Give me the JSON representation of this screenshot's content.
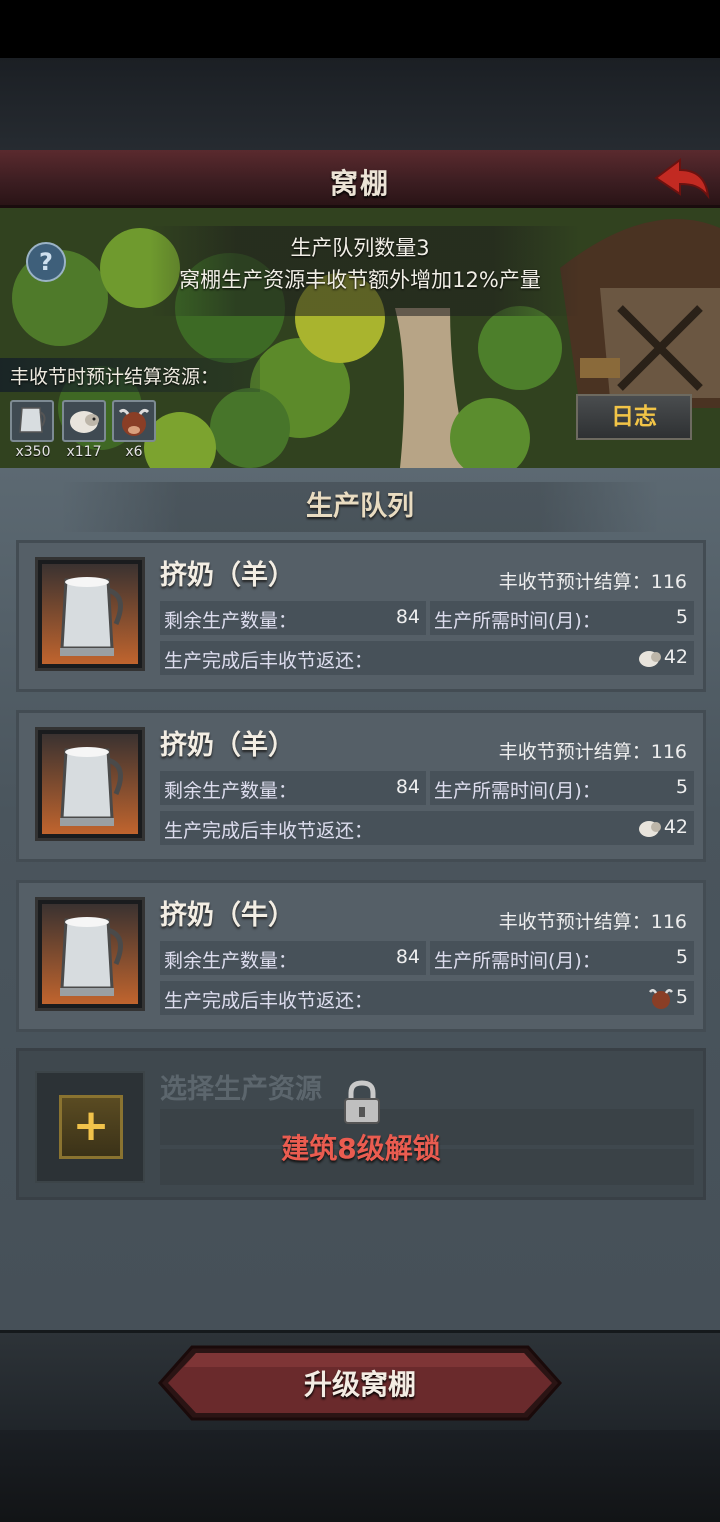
{
  "header": {
    "title": "窝棚"
  },
  "banner": {
    "queue_count_text": "生产队列数量3",
    "bonus_text": "窝棚生产资源丰收节额外增加12%产量",
    "resources_label": "丰收节时预计结算资源：",
    "resources": [
      {
        "icon": "milk-jug-icon",
        "count": "x350"
      },
      {
        "icon": "sheep-icon",
        "count": "x117"
      },
      {
        "icon": "cow-icon",
        "count": "x6"
      }
    ],
    "log_button": "日志",
    "help_symbol": "?"
  },
  "queue": {
    "title": "生产队列",
    "items": [
      {
        "name": "挤奶（羊）",
        "harvest_label": "丰收节预计结算：116",
        "remaining_label": "剩余生产数量：",
        "remaining_value": "84",
        "time_label": "生产所需时间(月)：",
        "time_value": "5",
        "return_label": "生产完成后丰收节返还：",
        "return_value": "42",
        "return_icon": "sheep-icon"
      },
      {
        "name": "挤奶（羊）",
        "harvest_label": "丰收节预计结算：116",
        "remaining_label": "剩余生产数量：",
        "remaining_value": "84",
        "time_label": "生产所需时间(月)：",
        "time_value": "5",
        "return_label": "生产完成后丰收节返还：",
        "return_value": "42",
        "return_icon": "sheep-icon"
      },
      {
        "name": "挤奶（牛）",
        "harvest_label": "丰收节预计结算：116",
        "remaining_label": "剩余生产数量：",
        "remaining_value": "84",
        "time_label": "生产所需时间(月)：",
        "time_value": "5",
        "return_label": "生产完成后丰收节返还：",
        "return_value": "5",
        "return_icon": "cow-icon"
      }
    ],
    "locked": {
      "name": "选择生产资源",
      "unlock_text": "建筑8级解锁",
      "plus_symbol": "+"
    }
  },
  "footer": {
    "upgrade_label": "升级窝棚"
  },
  "colors": {
    "accent_red": "#ea5c50",
    "gold": "#f2c447",
    "title_bar": "#3b1d21"
  }
}
